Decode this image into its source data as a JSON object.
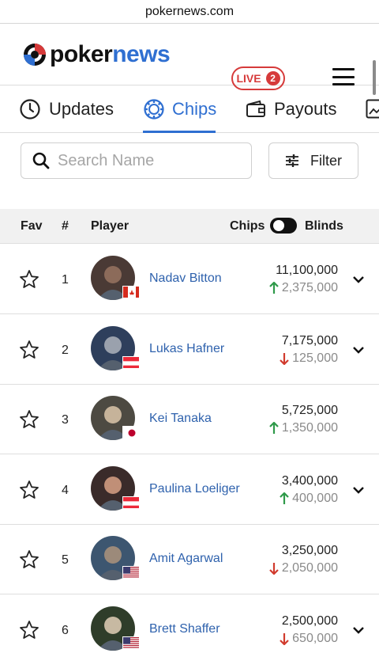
{
  "browser": {
    "url": "pokernews.com"
  },
  "header": {
    "logo_poker": "poker",
    "logo_news": "news",
    "live_label": "LIVE",
    "live_count": "2"
  },
  "tabs": [
    {
      "label": "Updates",
      "icon": "clock-icon"
    },
    {
      "label": "Chips",
      "icon": "poker-chip-icon",
      "active": true
    },
    {
      "label": "Payouts",
      "icon": "wallet-icon"
    },
    {
      "label": "",
      "icon": "image-icon"
    }
  ],
  "search": {
    "placeholder": "Search Name",
    "value": ""
  },
  "filter": {
    "label": "Filter"
  },
  "table": {
    "headers": {
      "fav": "Fav",
      "rank": "#",
      "player": "Player",
      "chips": "Chips",
      "blinds": "Blinds"
    },
    "rows": [
      {
        "rank": "1",
        "name": "Nadav Bitton",
        "chips": "11,100,000",
        "delta": "2,375,000",
        "direction": "up",
        "country": "CA",
        "expandable": true
      },
      {
        "rank": "2",
        "name": "Lukas Hafner",
        "chips": "7,175,000",
        "delta": "125,000",
        "direction": "down",
        "country": "AT",
        "expandable": true
      },
      {
        "rank": "3",
        "name": "Kei Tanaka",
        "chips": "5,725,000",
        "delta": "1,350,000",
        "direction": "up",
        "country": "JP",
        "expandable": false
      },
      {
        "rank": "4",
        "name": "Paulina Loeliger",
        "chips": "3,400,000",
        "delta": "400,000",
        "direction": "up",
        "country": "AT",
        "expandable": true
      },
      {
        "rank": "5",
        "name": "Amit Agarwal",
        "chips": "3,250,000",
        "delta": "2,050,000",
        "direction": "down",
        "country": "US",
        "expandable": false
      },
      {
        "rank": "6",
        "name": "Brett Shaffer",
        "chips": "2,500,000",
        "delta": "650,000",
        "direction": "down",
        "country": "US",
        "expandable": true
      }
    ]
  },
  "colors": {
    "accent": "#2f6fd1",
    "live": "#d63a3a",
    "up": "#2f9a4a",
    "down": "#d13b2e"
  }
}
